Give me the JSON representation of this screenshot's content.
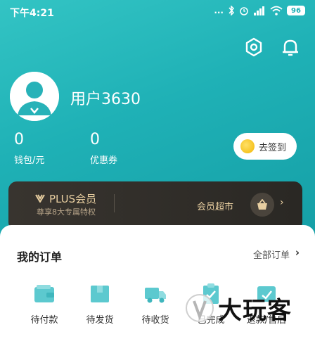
{
  "status_bar": {
    "time": "下午4:21",
    "signal_text": "...",
    "battery": "96"
  },
  "header": {
    "settings_icon": "hexagon-settings-icon",
    "bell_icon": "bell-icon"
  },
  "profile": {
    "username": "用户3630",
    "avatar_icon": "user-avatar-icon"
  },
  "stats": {
    "wallet_value": "0",
    "wallet_label": "钱包/元",
    "coupon_value": "0",
    "coupon_label": "优惠券"
  },
  "signin": {
    "label": "去签到"
  },
  "plus": {
    "title": "PLUS会员",
    "subtitle": "尊享8大专属特权",
    "market": "会员超市",
    "arrow": "›"
  },
  "orders": {
    "title": "我的订单",
    "all_label": "全部订单",
    "all_arrow": "›",
    "items": [
      {
        "label": "待付款",
        "icon": "wallet-icon"
      },
      {
        "label": "待发货",
        "icon": "box-icon"
      },
      {
        "label": "待收货",
        "icon": "truck-icon"
      },
      {
        "label": "已完成",
        "icon": "clipboard-check-icon"
      },
      {
        "label": "退款/售后",
        "icon": "refund-icon"
      }
    ]
  },
  "watermark": {
    "text": "大玩客"
  },
  "colors": {
    "header_teal": "#1fb1b6",
    "order_icon_teal": "#5cc9cf",
    "plus_gold": "#e9cfa1"
  }
}
